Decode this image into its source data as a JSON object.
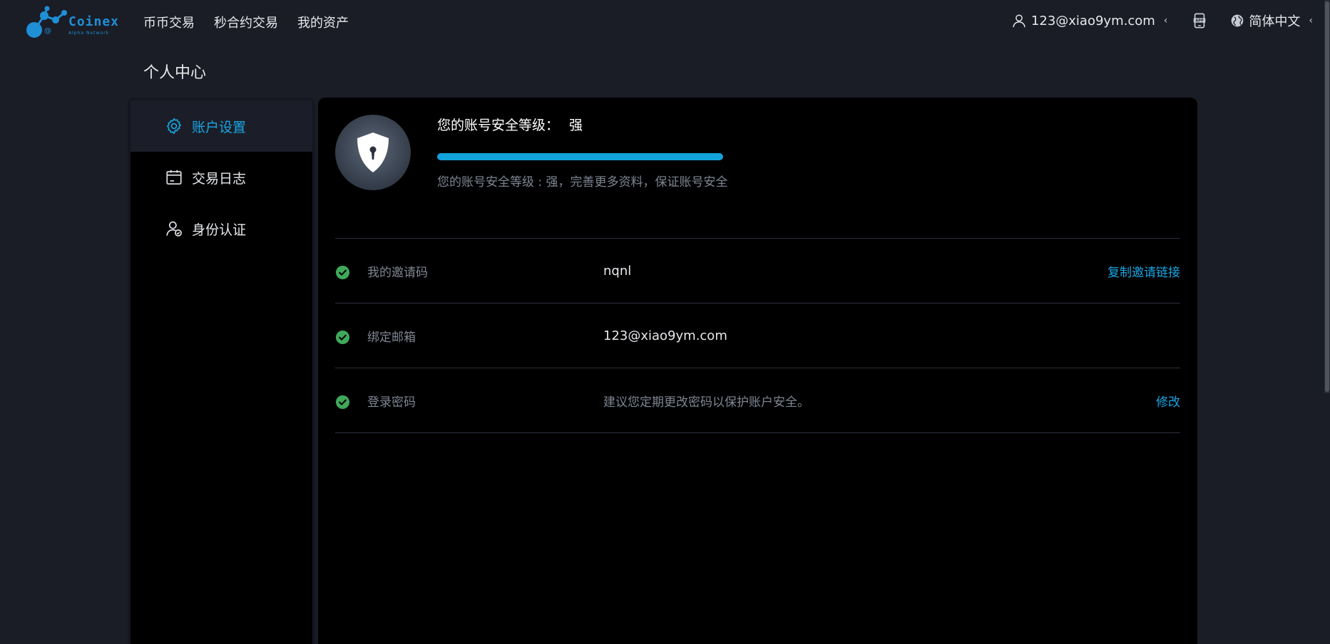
{
  "brand": {
    "name": "Coinex",
    "tagline": "Alpha Network"
  },
  "nav": {
    "items": [
      "币币交易",
      "秒合约交易",
      "我的资产"
    ]
  },
  "header": {
    "user_email": "123@xiao9ym.com",
    "language": "简体中文"
  },
  "page": {
    "title": "个人中心"
  },
  "sidebar": {
    "items": [
      {
        "label": "账户设置",
        "icon": "gear-icon",
        "active": true
      },
      {
        "label": "交易日志",
        "icon": "calendar-icon",
        "active": false
      },
      {
        "label": "身份认证",
        "icon": "user-verify-icon",
        "active": false
      }
    ]
  },
  "security": {
    "title": "您的账号安全等级：",
    "level": "强",
    "progress_percent": 100,
    "tip": "您的账号安全等级 : 强，完善更多资料，保证账号安全"
  },
  "rows": [
    {
      "label": "我的邀请码",
      "value": "nqnl",
      "action": "复制邀请链接"
    },
    {
      "label": "绑定邮箱",
      "value": "123@xiao9ym.com",
      "action": ""
    },
    {
      "label": "登录密码",
      "value": "建议您定期更改密码以保护账户安全。",
      "action": "修改"
    }
  ],
  "colors": {
    "accent": "#19a6e5",
    "success": "#3fa95a",
    "panel": "#000000",
    "background": "#1a1d26"
  }
}
